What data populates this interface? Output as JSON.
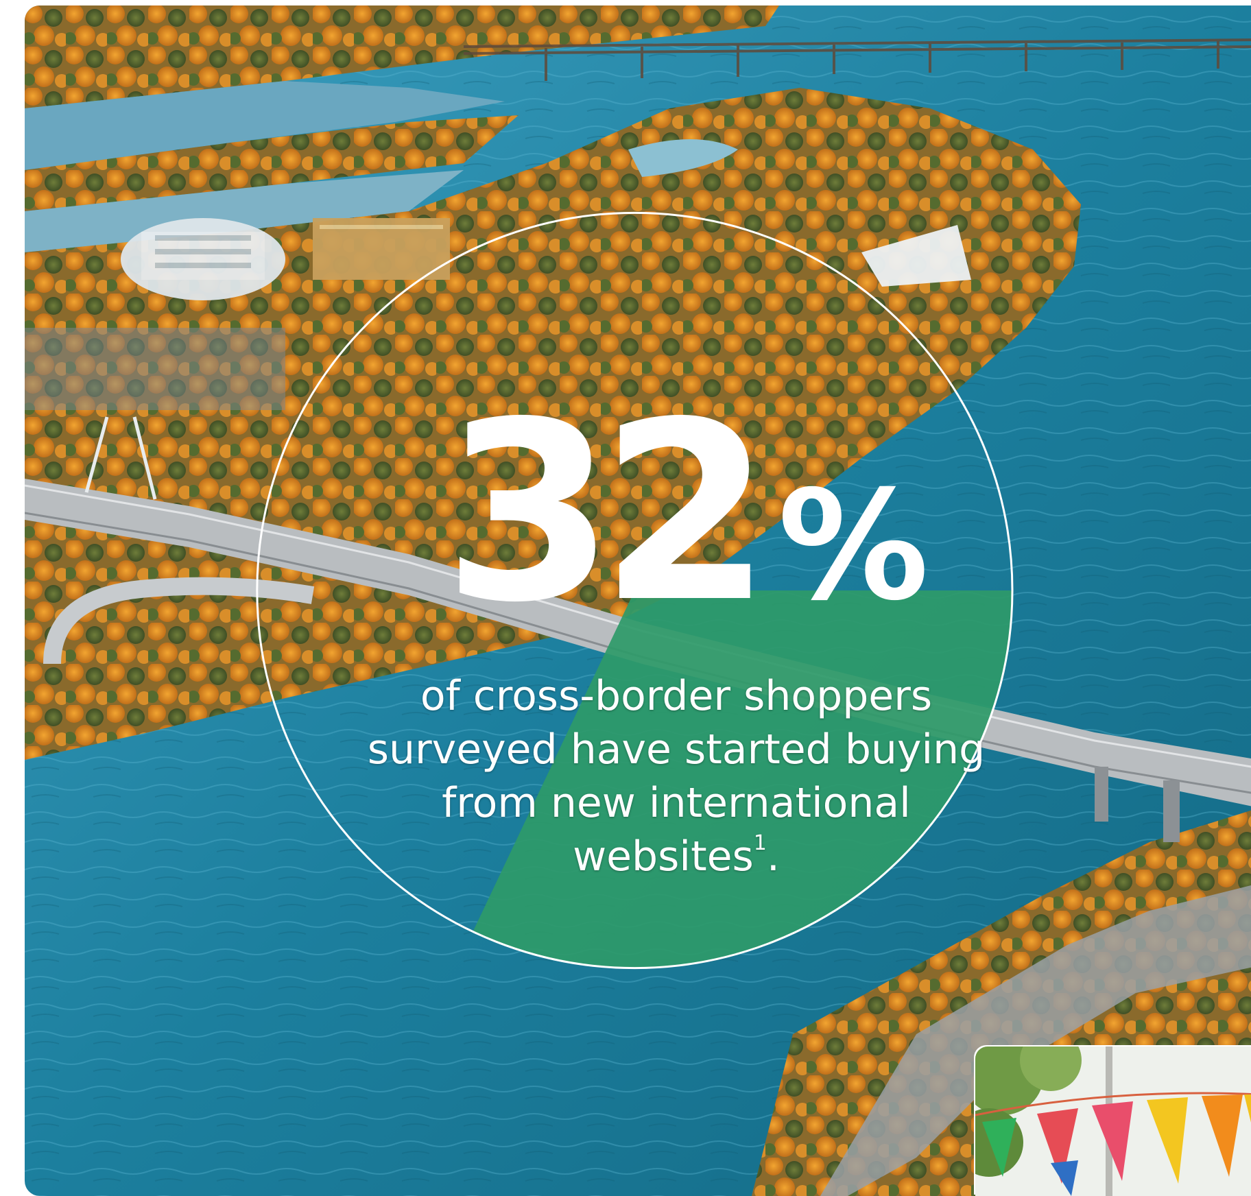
{
  "stat": {
    "number": "32",
    "unit": "%",
    "fraction": 0.32,
    "caption_lines": [
      "of cross-border shoppers",
      "surveyed have started buying",
      "from new international"
    ],
    "caption_last": "websites",
    "footnote_mark": "1",
    "caption_end": "."
  },
  "colors": {
    "accent_green": "#2e9a69",
    "water": "#1f7d98",
    "foliage_orange": "#e08a1e",
    "ring": "#ffffff"
  },
  "icons": {
    "background": "aerial-river-island-photo",
    "corner_thumb": "festival-bunting-photo"
  }
}
